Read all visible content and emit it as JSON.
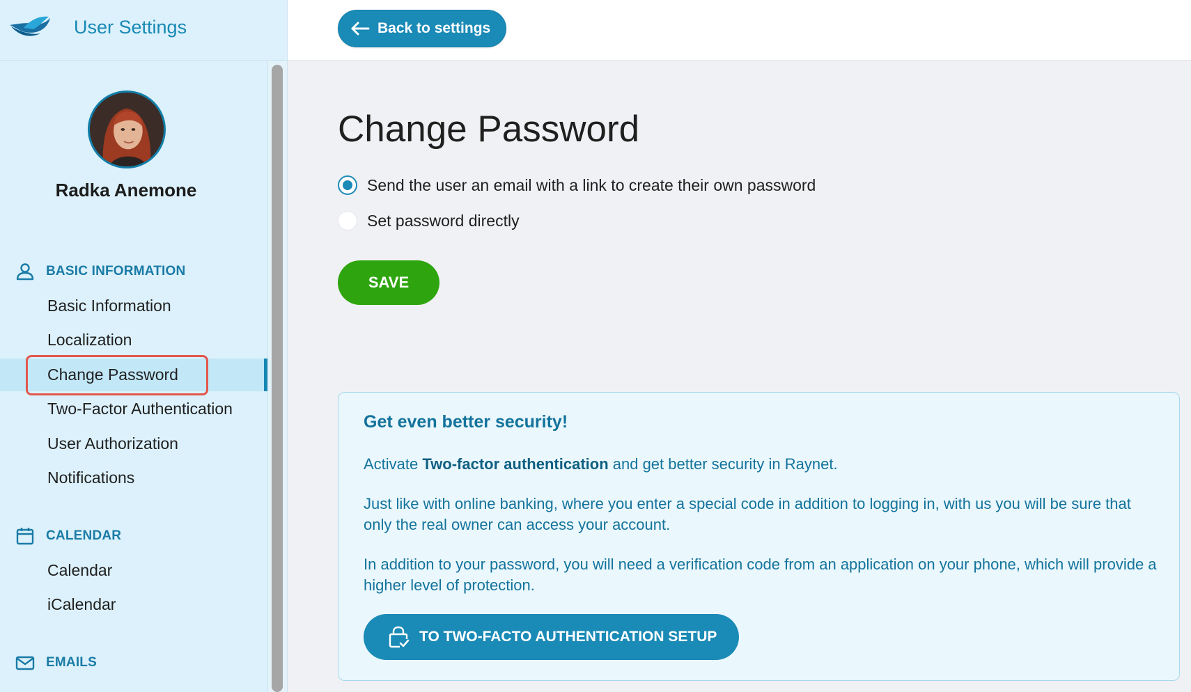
{
  "app": {
    "title": "User Settings"
  },
  "user": {
    "name": "Radka Anemone"
  },
  "topbar": {
    "back_label": "Back to settings"
  },
  "sidebar": {
    "sections": [
      {
        "heading": "BASIC INFORMATION",
        "icon": "person-icon",
        "items": [
          "Basic Information",
          "Localization",
          "Change Password",
          "Two-Factor Authentication",
          "User Authorization",
          "Notifications"
        ]
      },
      {
        "heading": "CALENDAR",
        "icon": "calendar-icon",
        "items": [
          "Calendar",
          "iCalendar"
        ]
      },
      {
        "heading": "EMAILS",
        "icon": "mail-icon",
        "items": []
      }
    ],
    "active_item": "Change Password"
  },
  "main": {
    "title": "Change Password",
    "options": [
      {
        "label": "Send the user an email with a link to create their own password",
        "checked": true
      },
      {
        "label": "Set password directly",
        "checked": false
      }
    ],
    "save_label": "SAVE"
  },
  "info_box": {
    "title": "Get even better security!",
    "p1_before": "Activate ",
    "p1_bold": "Two-factor authentication",
    "p1_after": " and get better security in Raynet.",
    "p2": "Just like with online banking, where you enter a special code in addition to logging in, with us you will be sure that only the real owner can access your account.",
    "p3": "In addition to your password, you will need a verification code from an application on your phone, which will provide a higher level of protection.",
    "button_label": "TO TWO-FACTO AUTHENTICATION SETUP"
  },
  "colors": {
    "accent": "#1a8ab6",
    "save": "#2ea50e",
    "sidebar_bg": "#dcf1fb",
    "highlight": "#e2574c"
  }
}
